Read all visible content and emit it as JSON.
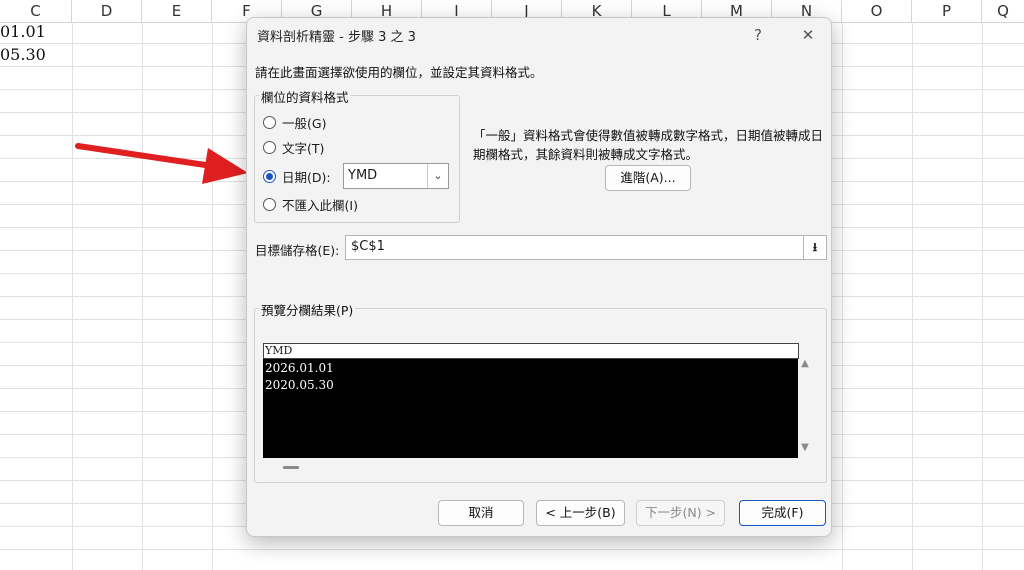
{
  "sheet": {
    "columns": [
      "C",
      "D",
      "E",
      "F",
      "G",
      "H",
      "I",
      "J",
      "K",
      "L",
      "M",
      "N",
      "O",
      "P",
      "Q"
    ],
    "cells": [
      "01.01",
      "05.30"
    ]
  },
  "dialog": {
    "title": "資料剖析精靈 - 步驟 3 之 3",
    "help": "?",
    "close": "✕",
    "instruction": "請在此畫面選擇欲使用的欄位，並設定其資料格式。",
    "format_group_label": "欄位的資料格式",
    "options": [
      {
        "label": "一般(G)",
        "checked": false
      },
      {
        "label": "文字(T)",
        "checked": false
      },
      {
        "label": "日期(D):",
        "checked": true
      },
      {
        "label": "不匯入此欄(I)",
        "checked": false
      }
    ],
    "date_format": "YMD",
    "description": "「一般」資料格式會使得數值被轉成數字格式，日期值被轉成日期欄格式，其餘資料則被轉成文字格式。",
    "advanced_button": "進階(A)...",
    "destination_label": "目標儲存格(E):",
    "destination_value": "$C$1",
    "preview_label": "預覽分欄結果(P)",
    "preview_header": "YMD",
    "preview_rows": [
      "2026.01.01",
      "2020.05.30"
    ],
    "buttons": {
      "cancel": "取消",
      "back": "< 上一步(B)",
      "next": "下一步(N) >",
      "finish": "完成(F)"
    }
  },
  "colors": {
    "accent": "#1a56c4",
    "arrow": "#e02020"
  }
}
